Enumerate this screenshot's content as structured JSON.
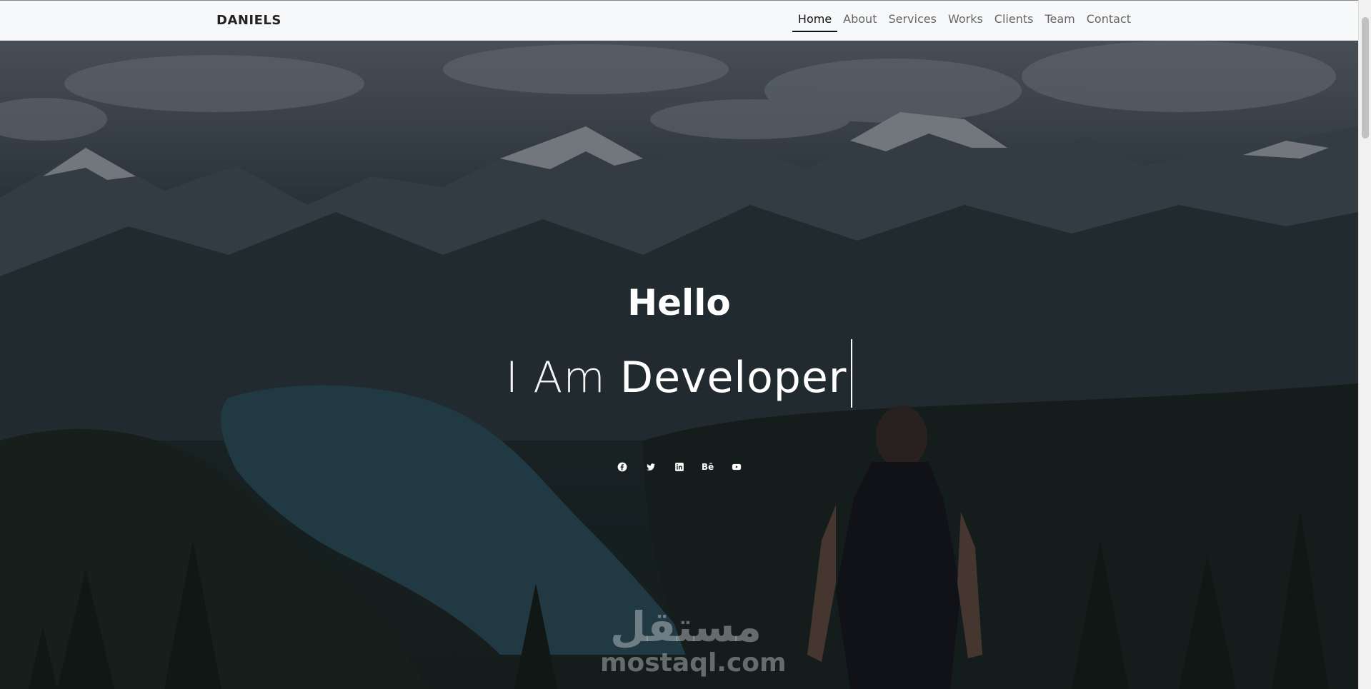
{
  "brand": "DANIELS",
  "nav": {
    "items": [
      {
        "label": "Home"
      },
      {
        "label": "About"
      },
      {
        "label": "Services"
      },
      {
        "label": "Works"
      },
      {
        "label": "Clients"
      },
      {
        "label": "Team"
      },
      {
        "label": "Contact"
      }
    ],
    "active": "Home"
  },
  "hero": {
    "greeting": "Hello",
    "prefix": "I Am",
    "role": "Developer"
  },
  "social": [
    {
      "icon": "facebook-icon"
    },
    {
      "icon": "twitter-icon"
    },
    {
      "icon": "linkedin-icon"
    },
    {
      "icon": "behance-icon",
      "label": "Bē"
    },
    {
      "icon": "youtube-icon"
    }
  ],
  "watermark": {
    "arabic": "مستقل",
    "domain": "mostaql.com"
  }
}
